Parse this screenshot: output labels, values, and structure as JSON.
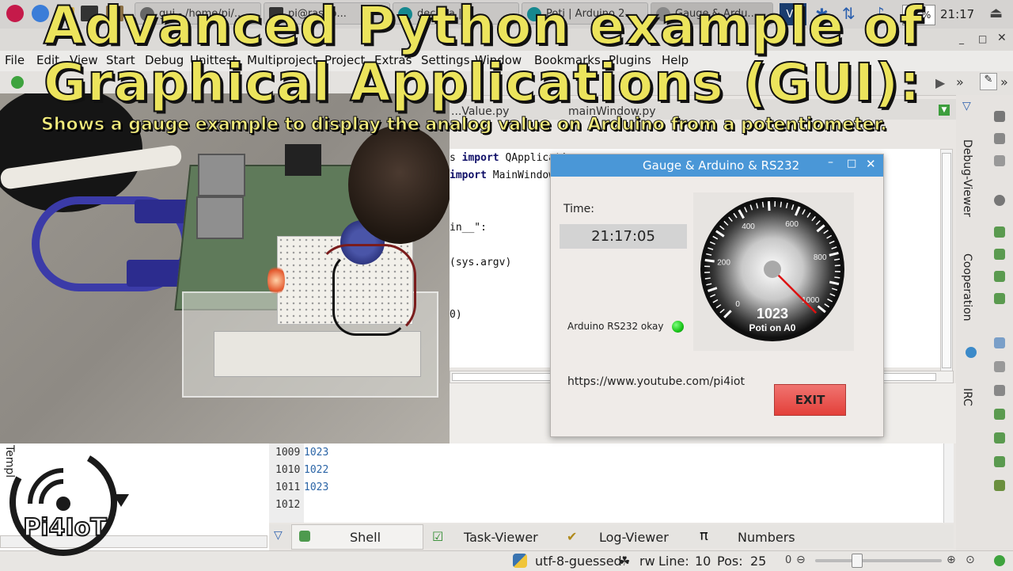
{
  "taskbar": {
    "tasks": [
      "gui - /home/pi/...",
      "pi@raspb...",
      "dec27a | ...",
      "Poti | Arduino 2...",
      "Gauge & Ardu..."
    ],
    "cpu": "23 %",
    "clock": "21:17"
  },
  "overlay": {
    "line1": "Advanced Python example of",
    "line2": "Graphical Applications (GUI):",
    "line3": "Shows a gauge example to display the analog value on Arduino from a potentiometer."
  },
  "ide": {
    "menu": [
      "File",
      "Edit",
      "View",
      "Start",
      "Debug",
      "Unittest",
      "Multiproject",
      "Project",
      "Extras",
      "Settings",
      "Window",
      "Bookmarks",
      "Plugins",
      "Help"
    ],
    "editor_tabs": [
      "...Value.py",
      "mainWindow.py"
    ],
    "code_lines": [
      {
        "kw": "import",
        "pre": "s ",
        "post": " QApplicatio"
      },
      {
        "kw": "import",
        "pre": "",
        "post": " MainWindow"
      },
      {
        "kw": "",
        "pre": "in__\":",
        "post": ""
      },
      {
        "kw": "",
        "pre": "(sys.argv)",
        "post": ""
      },
      {
        "kw": "",
        "pre": "0)",
        "post": ""
      }
    ],
    "shell_lines": [
      {
        "num": "1009",
        "val": "1023"
      },
      {
        "num": "1010",
        "val": "1022"
      },
      {
        "num": "1011",
        "val": "1023"
      },
      {
        "num": "1012",
        "val": ""
      }
    ],
    "bottom_tabs": [
      "Shell",
      "Task-Viewer",
      "Log-Viewer",
      "Numbers"
    ],
    "right_tabs": [
      "Debug-Viewer",
      "Cooperation",
      "IRC"
    ],
    "left_tab": "Templ",
    "status": {
      "encoding": "utf-8-guessed",
      "mode": "rw",
      "line_label": "Line:",
      "line": "10",
      "pos_label": "Pos:",
      "pos": "25",
      "zoom_value": "0"
    }
  },
  "gauge_window": {
    "title": "Gauge & Arduino & RS232",
    "time_label": "Time:",
    "time_value": "21:17:05",
    "status_label": "Arduino RS232 okay",
    "url": "https://www.youtube.com/pi4iot",
    "exit_label": "EXIT",
    "gauge": {
      "value": "1023",
      "caption": "Poti on A0",
      "min": 0,
      "max": 1023,
      "reading": 1023,
      "ticks": [
        "0",
        "200",
        "400",
        "600",
        "800",
        "1000"
      ]
    }
  },
  "logo": {
    "text": "Pi4IoT"
  }
}
